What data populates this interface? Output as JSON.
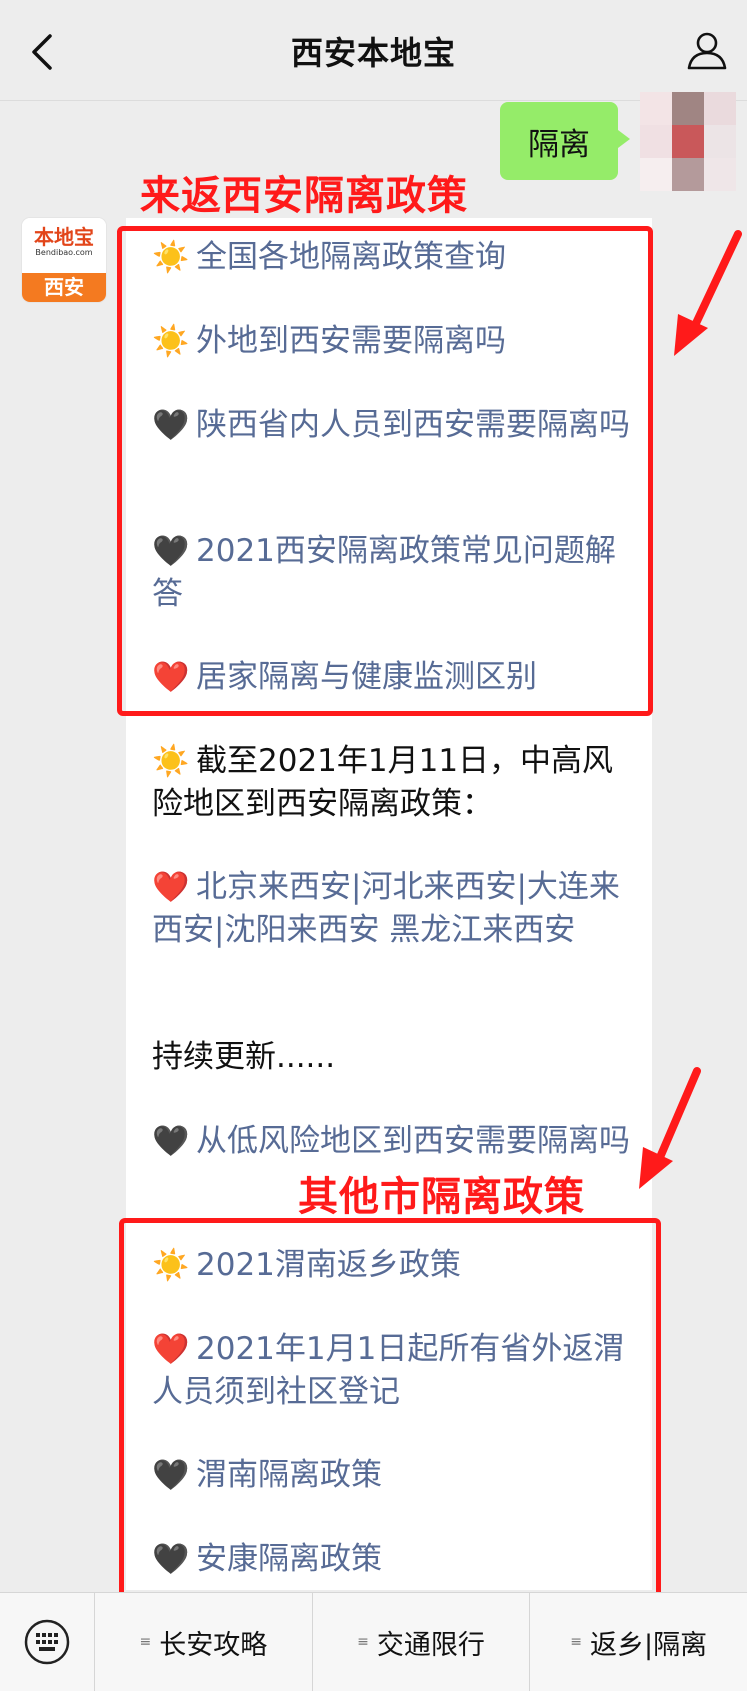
{
  "header": {
    "title": "西安本地宝"
  },
  "sent_message": {
    "text": "隔离"
  },
  "bot": {
    "avatar_logo": "本地宝",
    "avatar_sub": "Bendibao.com",
    "avatar_city": "西安"
  },
  "box1": {
    "label": "来返西安隔离政策",
    "items": [
      {
        "emoji": "☀️",
        "text": "全国各地隔离政策查询"
      },
      {
        "emoji": "☀️",
        "text": "外地到西安需要隔离吗"
      },
      {
        "emoji": "🖤",
        "text": "陕西省内人员到西安需要隔离吗"
      },
      {
        "emoji": "🖤",
        "text": "2021西安隔离政策常见问题解答"
      },
      {
        "emoji": "❤️",
        "text": "居家隔离与健康监测区别"
      }
    ]
  },
  "middle": {
    "notice_emoji": "☀️",
    "notice": "截至2021年1月11日，中高风险地区到西安隔离政策：",
    "links_emoji": "❤️",
    "links": "北京来西安|河北来西安|大连来西安|沈阳来西安 黑龙江来西安",
    "updating": "持续更新......",
    "low_risk_emoji": "🖤",
    "low_risk": "从低风险地区到西安需要隔离吗"
  },
  "box2": {
    "label": "其他市隔离政策",
    "items": [
      {
        "emoji": "☀️",
        "text": "2021渭南返乡政策"
      },
      {
        "emoji": "❤️",
        "text": "2021年1月1日起所有省外返渭人员须到社区登记"
      },
      {
        "emoji": "🖤",
        "text": "渭南隔离政策"
      },
      {
        "emoji": "🖤",
        "text": "安康隔离政策"
      }
    ]
  },
  "tabbar": {
    "tabs": [
      {
        "label": "长安攻略"
      },
      {
        "label": "交通限行"
      },
      {
        "label": "返乡|隔离"
      }
    ]
  },
  "colors": {
    "link": "#576b95",
    "highlight": "#ff1a1a",
    "bubble": "#95ec69"
  }
}
